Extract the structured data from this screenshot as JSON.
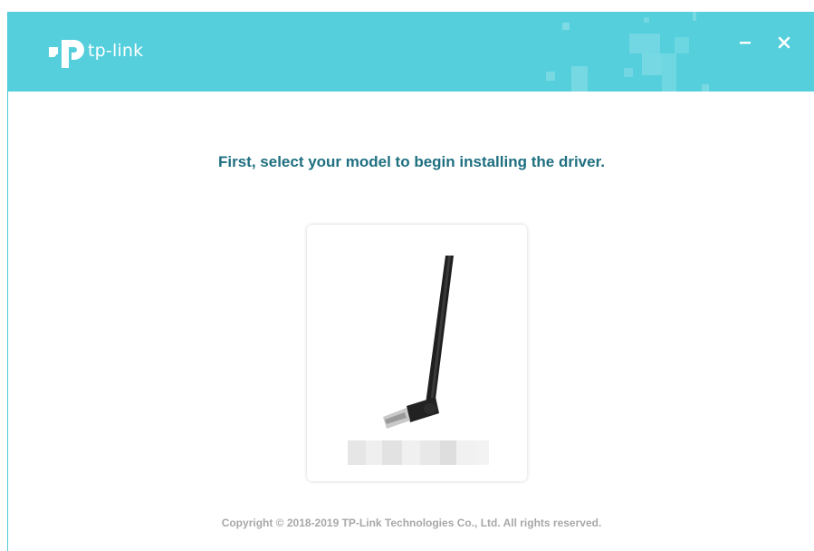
{
  "app": {
    "brand_name": "tp-link",
    "brand_color": "#55cfdc",
    "heading_color": "#1e6f80"
  },
  "titlebar": {
    "minimize_icon": "minimize-icon",
    "close_icon": "close-icon"
  },
  "main": {
    "heading": "First, select your model to begin installing the driver.",
    "model_card": {
      "image": "usb-wifi-adapter-with-antenna",
      "label": ""
    }
  },
  "footer": {
    "copyright": "Copyright © 2018-2019 TP-Link Technologies Co., Ltd. All rights reserved."
  }
}
